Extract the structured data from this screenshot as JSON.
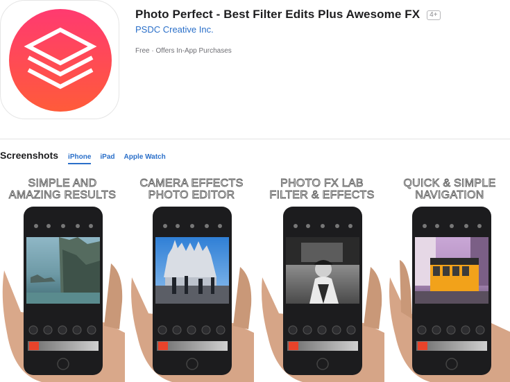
{
  "app": {
    "title": "Photo Perfect - Best Filter Edits Plus Awesome FX",
    "age_rating": "4+",
    "developer": "PSDC Creative Inc.",
    "price_line": "Free · Offers In-App Purchases",
    "icon": "stacked-layers-icon"
  },
  "screenshots": {
    "heading": "Screenshots",
    "tabs": [
      {
        "label": "iPhone",
        "active": true
      },
      {
        "label": "iPad",
        "active": false
      },
      {
        "label": "Apple Watch",
        "active": false
      }
    ],
    "items": [
      {
        "line1": "SIMPLE AND",
        "line2": "AMAZING RESULTS",
        "scene": "cliffs-lake"
      },
      {
        "line1": "CAMERA EFFECTS",
        "line2": "PHOTO EDITOR",
        "scene": "cathedral-square"
      },
      {
        "line1": "PHOTO FX LAB",
        "line2": "FILTER & EFFECTS",
        "scene": "black-white-street"
      },
      {
        "line1": "QUICK & SIMPLE",
        "line2": "NAVIGATION",
        "scene": "orange-tram"
      }
    ]
  },
  "colors": {
    "link": "#2a6fc9",
    "icon_gradient_top": "#ff3b6b",
    "icon_gradient_bottom": "#ff5a3c",
    "phone_body": "#1c1c1e",
    "accent_button": "#e8432a"
  }
}
